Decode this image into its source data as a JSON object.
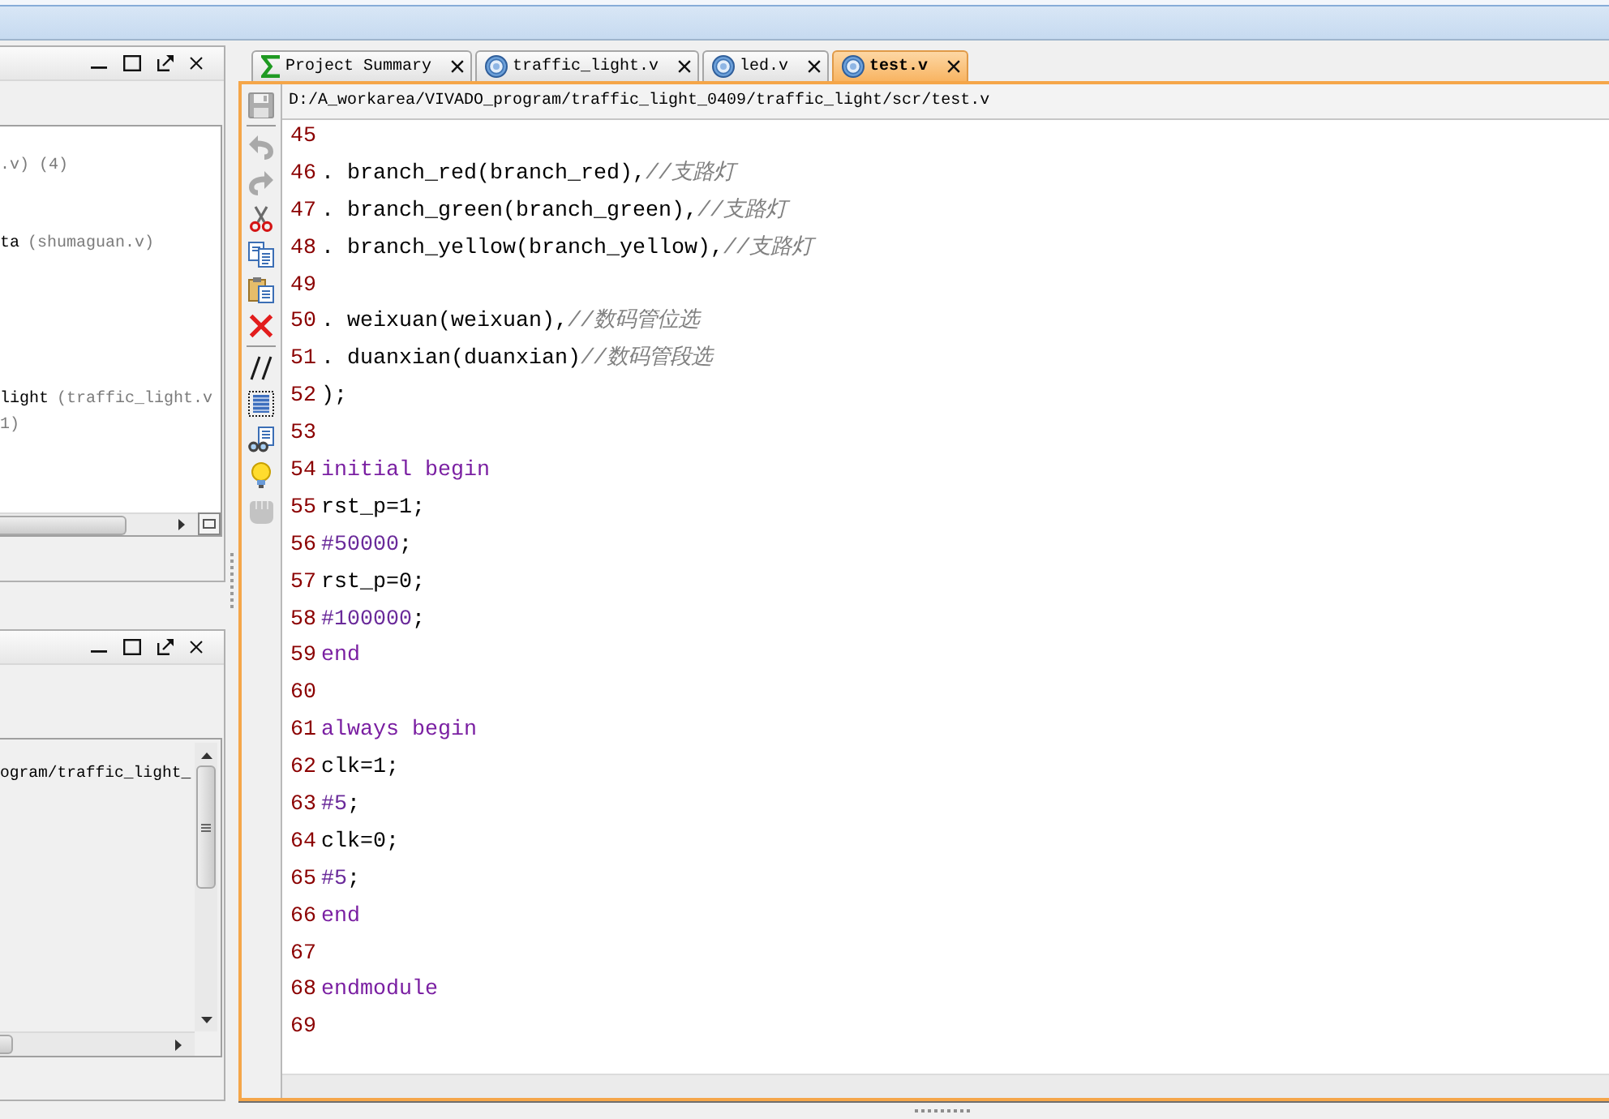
{
  "left_panels": [
    {
      "rows": [
        {
          "detail": ".v) (4)"
        },
        {
          "label": "ta",
          "detail": "(shumaguan.v)"
        },
        {
          "label": "light",
          "detail": "(traffic_light.v"
        },
        {
          "detail": "1)"
        }
      ]
    },
    {
      "rows": [
        {
          "label": "ogram/traffic_light_"
        }
      ]
    }
  ],
  "editor": {
    "tabs": [
      {
        "kind": "summary",
        "label": "Project Summary",
        "selected": false
      },
      {
        "kind": "file",
        "label": "traffic_light.v",
        "selected": false
      },
      {
        "kind": "file",
        "label": "led.v",
        "selected": false
      },
      {
        "kind": "file",
        "label": "test.v",
        "selected": true
      }
    ],
    "path": "D:/A_workarea/VIVADO_program/traffic_light_0409/traffic_light/scr/test.v",
    "toolbar_groups": [
      [
        {
          "kind": "save",
          "disabled": true
        }
      ],
      [
        {
          "kind": "undo",
          "disabled": true
        },
        {
          "kind": "redo",
          "disabled": true
        },
        {
          "kind": "cut",
          "disabled": false
        },
        {
          "kind": "copy",
          "disabled": false
        },
        {
          "kind": "paste",
          "disabled": false
        },
        {
          "kind": "delete",
          "disabled": false
        }
      ],
      [
        {
          "kind": "comment",
          "disabled": false
        },
        {
          "kind": "column_select",
          "disabled": false
        },
        {
          "kind": "find",
          "disabled": false
        },
        {
          "kind": "hint",
          "disabled": false
        },
        {
          "kind": "hand",
          "disabled": true
        }
      ]
    ],
    "lines": [
      {
        "number": "45"
      },
      {
        "number": "46",
        "segments": [
          {
            "kind": "code",
            "text": ". branch_red(branch_red),"
          },
          {
            "kind": "comment",
            "text": "//支路灯"
          }
        ]
      },
      {
        "number": "47",
        "segments": [
          {
            "kind": "code",
            "text": ". branch_green(branch_green),"
          },
          {
            "kind": "comment",
            "text": "//支路灯"
          }
        ]
      },
      {
        "number": "48",
        "segments": [
          {
            "kind": "code",
            "text": ". branch_yellow(branch_yellow),"
          },
          {
            "kind": "comment",
            "text": "//支路灯"
          }
        ]
      },
      {
        "number": "49"
      },
      {
        "number": "50",
        "segments": [
          {
            "kind": "code",
            "text": ". weixuan(weixuan),"
          },
          {
            "kind": "comment",
            "text": "//数码管位选"
          }
        ]
      },
      {
        "number": "51",
        "segments": [
          {
            "kind": "code",
            "text": ". duanxian(duanxian)"
          },
          {
            "kind": "comment",
            "text": "//数码管段选"
          }
        ]
      },
      {
        "number": "52",
        "segments": [
          {
            "kind": "code",
            "text": ");"
          }
        ]
      },
      {
        "number": "53"
      },
      {
        "number": "54",
        "segments": [
          {
            "kind": "keyword",
            "text": "initial begin"
          }
        ]
      },
      {
        "number": "55",
        "segments": [
          {
            "kind": "code",
            "text": "rst_p=1;"
          }
        ]
      },
      {
        "number": "56",
        "segments": [
          {
            "kind": "delay",
            "text": "#50000"
          },
          {
            "kind": "code",
            "text": ";"
          }
        ]
      },
      {
        "number": "57",
        "segments": [
          {
            "kind": "code",
            "text": "rst_p=0;"
          }
        ]
      },
      {
        "number": "58",
        "segments": [
          {
            "kind": "delay",
            "text": "#100000"
          },
          {
            "kind": "code",
            "text": ";"
          }
        ]
      },
      {
        "number": "59",
        "segments": [
          {
            "kind": "keyword",
            "text": "end"
          }
        ]
      },
      {
        "number": "60"
      },
      {
        "number": "61",
        "segments": [
          {
            "kind": "keyword",
            "text": "always begin"
          }
        ]
      },
      {
        "number": "62",
        "segments": [
          {
            "kind": "code",
            "text": "clk=1;"
          }
        ]
      },
      {
        "number": "63",
        "segments": [
          {
            "kind": "delay",
            "text": "#5"
          },
          {
            "kind": "code",
            "text": ";"
          }
        ]
      },
      {
        "number": "64",
        "segments": [
          {
            "kind": "code",
            "text": "clk=0;"
          }
        ]
      },
      {
        "number": "65",
        "segments": [
          {
            "kind": "delay",
            "text": "#5"
          },
          {
            "kind": "code",
            "text": ";"
          }
        ]
      },
      {
        "number": "66",
        "segments": [
          {
            "kind": "keyword",
            "text": "end"
          }
        ]
      },
      {
        "number": "67"
      },
      {
        "number": "68",
        "segments": [
          {
            "kind": "keyword",
            "text": "endmodule"
          }
        ]
      },
      {
        "number": "69"
      }
    ]
  }
}
